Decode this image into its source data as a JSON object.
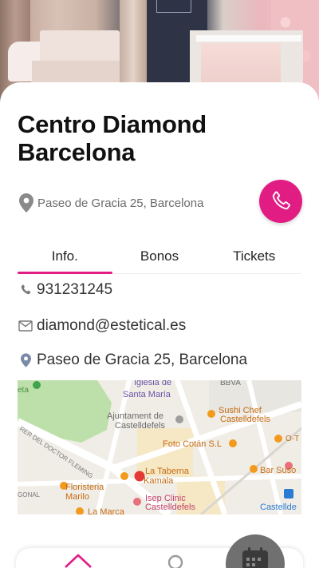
{
  "business": {
    "name": "Centro Diamond Barcelona",
    "address": "Paseo de Gracia 25, Barcelona"
  },
  "tabs": [
    {
      "label": "Info.",
      "active": true
    },
    {
      "label": "Bonos",
      "active": false
    },
    {
      "label": "Tickets",
      "active": false
    }
  ],
  "info": {
    "phone": "931231245",
    "email": "diamond@estetical.es",
    "address": "Paseo de Gracia 25, Barcelona"
  },
  "map": {
    "labels": {
      "eta": "eta",
      "bbva": "BBVA",
      "iglesia_1": "Iglesia de",
      "iglesia_2": "Santa María",
      "ajuntament_1": "Ajuntament de",
      "ajuntament_2": "Castelldefels",
      "sushi_1": "Sushi Chef",
      "sushi_2": "Castelldefels",
      "foto": "Foto Cotán S.L",
      "street": "RER DEL DOCTOR FLEMING",
      "taberna_1": "La Taberna",
      "taberna_2": "Kamala",
      "bar": "Bar Suso",
      "floristeria_1": "Floristeria",
      "floristeria_2": "Marilo",
      "isep_1": "Isep Clinic",
      "isep_2": "Castelldefels",
      "marca": "La Marca",
      "gonal": "GONAL",
      "o_t": "O-T",
      "castellde": "Castellde"
    },
    "colors": {
      "park": "#b8dfa6",
      "road": "#ffffff",
      "block": "#efece6",
      "label_orange": "#c46a12",
      "label_gray": "#6b6b6b",
      "label_purple": "#6a53a6",
      "pin": "#e53935"
    }
  },
  "colors": {
    "accent": "#e11d84",
    "fab": "#707070",
    "tab_underline": "#e11d84"
  },
  "icons": {
    "location": "location-pin-icon",
    "call": "phone-icon",
    "phone": "phone-icon",
    "email": "envelope-icon",
    "home": "home-icon",
    "search": "search-icon",
    "calendar": "calendar-icon"
  }
}
